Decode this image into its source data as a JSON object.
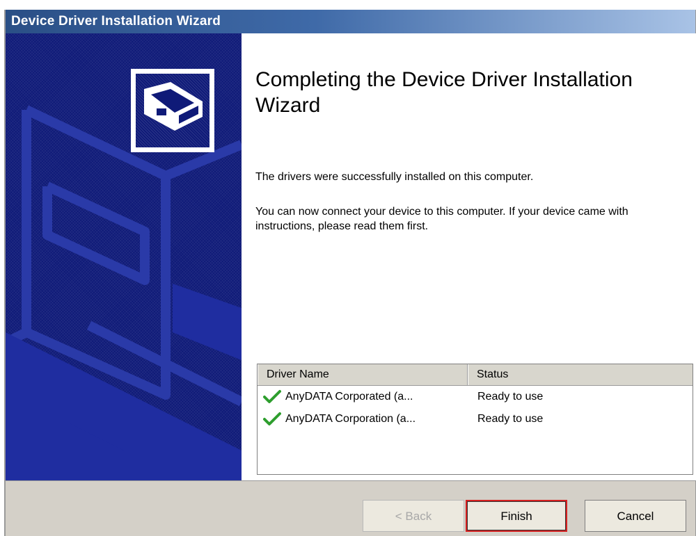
{
  "window": {
    "title": "Device Driver Installation Wizard"
  },
  "content": {
    "heading": "Completing the Device Driver Installation Wizard",
    "success_text": "The drivers were successfully installed on this computer.",
    "instructions_text": "You can now connect your device to this computer. If your device came with instructions, please read them first."
  },
  "driver_list": {
    "columns": [
      "Driver Name",
      "Status"
    ],
    "rows": [
      {
        "name": "AnyDATA Corporated (a...",
        "status": "Ready to use"
      },
      {
        "name": "AnyDATA Corporation (a...",
        "status": "Ready to use"
      }
    ],
    "status_icon": "check-icon",
    "check_color": "#2e9e2e"
  },
  "buttons": {
    "back": "< Back",
    "finish": "Finish",
    "cancel": "Cancel"
  },
  "colors": {
    "title_bar": "#2a4f86",
    "side_panel": "#0f1a78",
    "button_face": "#ece9df",
    "dialog_face": "#d4d0c8",
    "focus_highlight": "#d62020"
  }
}
